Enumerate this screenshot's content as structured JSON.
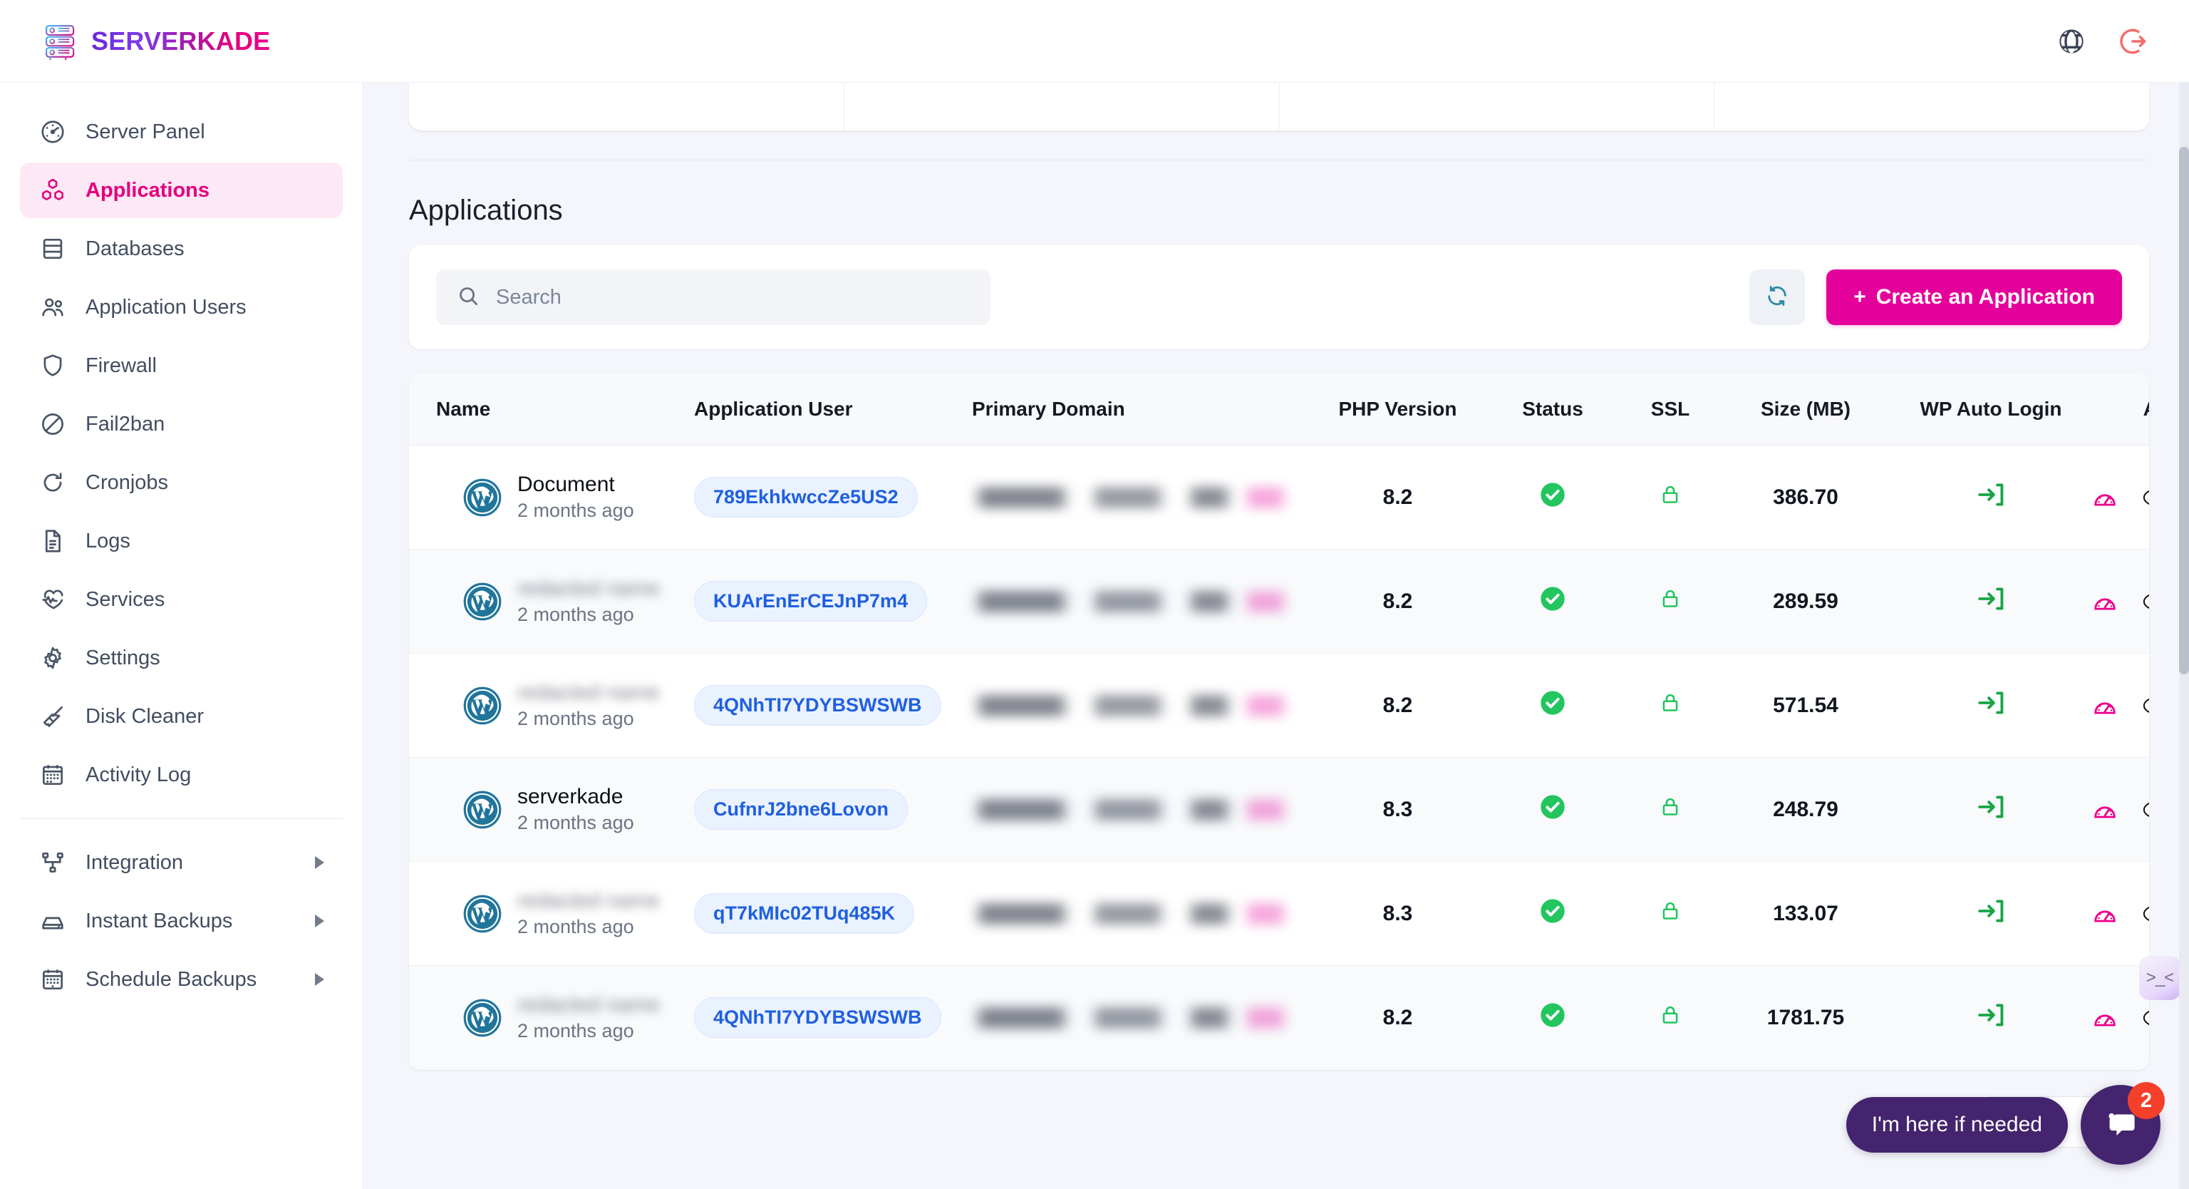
{
  "brand": {
    "name": "SERVERKADE",
    "logo_icon": "server-rack-icon"
  },
  "header": {
    "language_icon": "globe-icon",
    "logout_icon": "logout-icon"
  },
  "sidebar": {
    "items": [
      {
        "label": "Server Panel",
        "icon": "gauge-icon",
        "active": false,
        "expandable": false
      },
      {
        "label": "Applications",
        "icon": "cubes-icon",
        "active": true,
        "expandable": false
      },
      {
        "label": "Databases",
        "icon": "database-icon",
        "active": false,
        "expandable": false
      },
      {
        "label": "Application Users",
        "icon": "users-icon",
        "active": false,
        "expandable": false
      },
      {
        "label": "Firewall",
        "icon": "shield-icon",
        "active": false,
        "expandable": false
      },
      {
        "label": "Fail2ban",
        "icon": "ban-icon",
        "active": false,
        "expandable": false
      },
      {
        "label": "Cronjobs",
        "icon": "refresh-icon",
        "active": false,
        "expandable": false
      },
      {
        "label": "Logs",
        "icon": "document-icon",
        "active": false,
        "expandable": false
      },
      {
        "label": "Services",
        "icon": "heart-pulse-icon",
        "active": false,
        "expandable": false
      },
      {
        "label": "Settings",
        "icon": "gear-icon",
        "active": false,
        "expandable": false
      },
      {
        "label": "Disk Cleaner",
        "icon": "broom-icon",
        "active": false,
        "expandable": false
      },
      {
        "label": "Activity Log",
        "icon": "calendar-icon",
        "active": false,
        "expandable": false
      }
    ],
    "group_items": [
      {
        "label": "Integration",
        "icon": "sitemap-icon",
        "expandable": true
      },
      {
        "label": "Instant Backups",
        "icon": "drive-icon",
        "expandable": true
      },
      {
        "label": "Schedule Backups",
        "icon": "calendar-icon",
        "expandable": true
      }
    ]
  },
  "main": {
    "page_title": "Applications",
    "search": {
      "placeholder": "Search",
      "value": "",
      "icon": "search-icon"
    },
    "refresh": {
      "icon": "refresh-icon",
      "label": ""
    },
    "create_button": {
      "label": "Create an Application",
      "plus": "+",
      "color": "#e4009a"
    },
    "table": {
      "columns": [
        "Name",
        "Application User",
        "Primary Domain",
        "PHP Version",
        "Status",
        "SSL",
        "Size (MB)",
        "WP Auto Login",
        "Actions"
      ],
      "rows": [
        {
          "name": "Document",
          "name_redacted": false,
          "age": "2 months ago",
          "user": "789EkhkwccZe5US2",
          "domain_redacted": true,
          "php": "8.2",
          "status": "active",
          "ssl": "secure",
          "size": "386.70",
          "wp_login": "login-arrow-icon"
        },
        {
          "name": "",
          "name_redacted": true,
          "age": "2 months ago",
          "user": "KUArEnErCEJnP7m4",
          "domain_redacted": true,
          "php": "8.2",
          "status": "active",
          "ssl": "secure",
          "size": "289.59",
          "wp_login": "login-arrow-icon"
        },
        {
          "name": "",
          "name_redacted": true,
          "age": "2 months ago",
          "user": "4QNhTI7YDYBSWSWB",
          "domain_redacted": true,
          "php": "8.2",
          "status": "active",
          "ssl": "secure",
          "size": "571.54",
          "wp_login": "login-arrow-icon"
        },
        {
          "name": "serverkade",
          "name_redacted": false,
          "age": "2 months ago",
          "user": "CufnrJ2bne6Lovon",
          "domain_redacted": true,
          "php": "8.3",
          "status": "active",
          "ssl": "secure",
          "size": "248.79",
          "wp_login": "login-arrow-icon"
        },
        {
          "name": "",
          "name_redacted": true,
          "age": "2 months ago",
          "user": "qT7kMIc02TUq485K",
          "domain_redacted": true,
          "php": "8.3",
          "status": "active",
          "ssl": "secure",
          "size": "133.07",
          "wp_login": "login-arrow-icon"
        },
        {
          "name": "",
          "name_redacted": true,
          "age": "2 months ago",
          "user": "4QNhTI7YDYBSWSWB",
          "domain_redacted": true,
          "php": "8.2",
          "status": "active",
          "ssl": "secure",
          "size": "1781.75",
          "wp_login": "login-arrow-icon"
        }
      ],
      "row_actions": [
        "gauge-icon",
        "php-icon",
        "trash-icon"
      ],
      "app_type_icon": "wordpress-icon"
    },
    "page_size": "10"
  },
  "chat": {
    "message": "I'm here if needed",
    "badge_count": "2",
    "icon": "chat-bubble-icon"
  },
  "side_handle": {
    "face": ">_<"
  },
  "colors": {
    "accent_pink": "#e4009a",
    "active_nav_bg": "#fde8f5",
    "status_green": "#22c55e",
    "user_pill_blue": "#1f5fe0",
    "chat_purple": "#44246e",
    "badge_red": "#f4402b",
    "trash_red": "#f4563f"
  }
}
